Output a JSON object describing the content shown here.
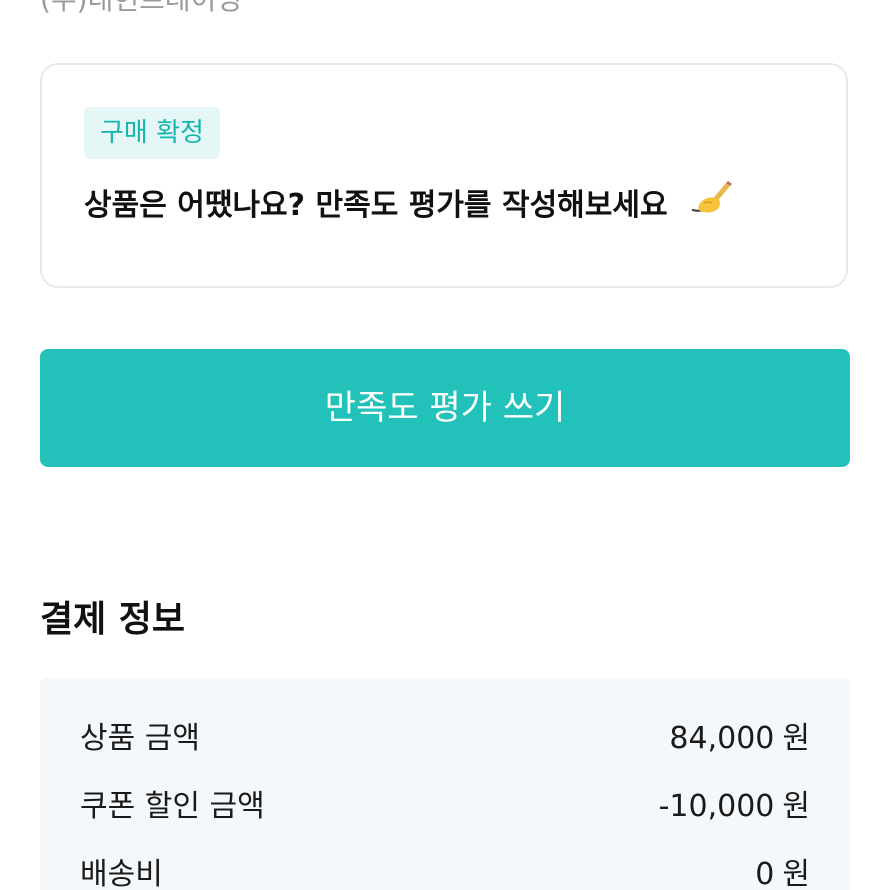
{
  "seller": {
    "name": "(주)대현트레이딩"
  },
  "review_card": {
    "badge": "구매 확정",
    "prompt": "상품은 어땠나요? 만족도 평가를 작성해보세요",
    "icon": "writing-hand-icon"
  },
  "review_button": {
    "label": "만족도 평가 쓰기"
  },
  "payment": {
    "title": "결제 정보",
    "rows": [
      {
        "label": "상품 금액",
        "amount": "84,000",
        "unit": "원"
      },
      {
        "label": "쿠폰 할인 금액",
        "amount": "-10,000",
        "unit": "원"
      },
      {
        "label": "배송비",
        "amount": "0",
        "unit": "원"
      }
    ]
  },
  "colors": {
    "accent": "#22c2bb",
    "badge_bg": "#e4f7f6",
    "badge_text": "#13b5ad",
    "payment_bg": "#f5f8fb"
  }
}
